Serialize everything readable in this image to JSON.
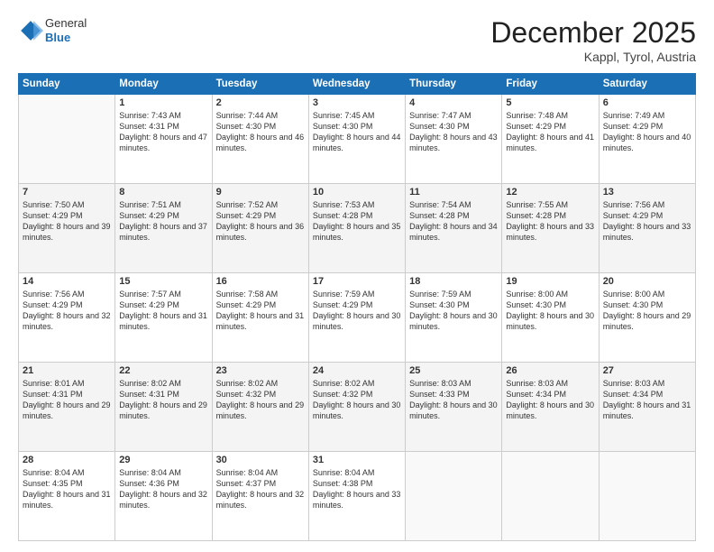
{
  "header": {
    "logo_general": "General",
    "logo_blue": "Blue",
    "title": "December 2025",
    "subtitle": "Kappl, Tyrol, Austria"
  },
  "days_of_week": [
    "Sunday",
    "Monday",
    "Tuesday",
    "Wednesday",
    "Thursday",
    "Friday",
    "Saturday"
  ],
  "weeks": [
    {
      "shaded": false,
      "days": [
        {
          "num": "",
          "empty": true,
          "sunrise": "",
          "sunset": "",
          "daylight": ""
        },
        {
          "num": "1",
          "empty": false,
          "sunrise": "Sunrise: 7:43 AM",
          "sunset": "Sunset: 4:31 PM",
          "daylight": "Daylight: 8 hours and 47 minutes."
        },
        {
          "num": "2",
          "empty": false,
          "sunrise": "Sunrise: 7:44 AM",
          "sunset": "Sunset: 4:30 PM",
          "daylight": "Daylight: 8 hours and 46 minutes."
        },
        {
          "num": "3",
          "empty": false,
          "sunrise": "Sunrise: 7:45 AM",
          "sunset": "Sunset: 4:30 PM",
          "daylight": "Daylight: 8 hours and 44 minutes."
        },
        {
          "num": "4",
          "empty": false,
          "sunrise": "Sunrise: 7:47 AM",
          "sunset": "Sunset: 4:30 PM",
          "daylight": "Daylight: 8 hours and 43 minutes."
        },
        {
          "num": "5",
          "empty": false,
          "sunrise": "Sunrise: 7:48 AM",
          "sunset": "Sunset: 4:29 PM",
          "daylight": "Daylight: 8 hours and 41 minutes."
        },
        {
          "num": "6",
          "empty": false,
          "sunrise": "Sunrise: 7:49 AM",
          "sunset": "Sunset: 4:29 PM",
          "daylight": "Daylight: 8 hours and 40 minutes."
        }
      ]
    },
    {
      "shaded": true,
      "days": [
        {
          "num": "7",
          "empty": false,
          "sunrise": "Sunrise: 7:50 AM",
          "sunset": "Sunset: 4:29 PM",
          "daylight": "Daylight: 8 hours and 39 minutes."
        },
        {
          "num": "8",
          "empty": false,
          "sunrise": "Sunrise: 7:51 AM",
          "sunset": "Sunset: 4:29 PM",
          "daylight": "Daylight: 8 hours and 37 minutes."
        },
        {
          "num": "9",
          "empty": false,
          "sunrise": "Sunrise: 7:52 AM",
          "sunset": "Sunset: 4:29 PM",
          "daylight": "Daylight: 8 hours and 36 minutes."
        },
        {
          "num": "10",
          "empty": false,
          "sunrise": "Sunrise: 7:53 AM",
          "sunset": "Sunset: 4:28 PM",
          "daylight": "Daylight: 8 hours and 35 minutes."
        },
        {
          "num": "11",
          "empty": false,
          "sunrise": "Sunrise: 7:54 AM",
          "sunset": "Sunset: 4:28 PM",
          "daylight": "Daylight: 8 hours and 34 minutes."
        },
        {
          "num": "12",
          "empty": false,
          "sunrise": "Sunrise: 7:55 AM",
          "sunset": "Sunset: 4:28 PM",
          "daylight": "Daylight: 8 hours and 33 minutes."
        },
        {
          "num": "13",
          "empty": false,
          "sunrise": "Sunrise: 7:56 AM",
          "sunset": "Sunset: 4:29 PM",
          "daylight": "Daylight: 8 hours and 33 minutes."
        }
      ]
    },
    {
      "shaded": false,
      "days": [
        {
          "num": "14",
          "empty": false,
          "sunrise": "Sunrise: 7:56 AM",
          "sunset": "Sunset: 4:29 PM",
          "daylight": "Daylight: 8 hours and 32 minutes."
        },
        {
          "num": "15",
          "empty": false,
          "sunrise": "Sunrise: 7:57 AM",
          "sunset": "Sunset: 4:29 PM",
          "daylight": "Daylight: 8 hours and 31 minutes."
        },
        {
          "num": "16",
          "empty": false,
          "sunrise": "Sunrise: 7:58 AM",
          "sunset": "Sunset: 4:29 PM",
          "daylight": "Daylight: 8 hours and 31 minutes."
        },
        {
          "num": "17",
          "empty": false,
          "sunrise": "Sunrise: 7:59 AM",
          "sunset": "Sunset: 4:29 PM",
          "daylight": "Daylight: 8 hours and 30 minutes."
        },
        {
          "num": "18",
          "empty": false,
          "sunrise": "Sunrise: 7:59 AM",
          "sunset": "Sunset: 4:30 PM",
          "daylight": "Daylight: 8 hours and 30 minutes."
        },
        {
          "num": "19",
          "empty": false,
          "sunrise": "Sunrise: 8:00 AM",
          "sunset": "Sunset: 4:30 PM",
          "daylight": "Daylight: 8 hours and 30 minutes."
        },
        {
          "num": "20",
          "empty": false,
          "sunrise": "Sunrise: 8:00 AM",
          "sunset": "Sunset: 4:30 PM",
          "daylight": "Daylight: 8 hours and 29 minutes."
        }
      ]
    },
    {
      "shaded": true,
      "days": [
        {
          "num": "21",
          "empty": false,
          "sunrise": "Sunrise: 8:01 AM",
          "sunset": "Sunset: 4:31 PM",
          "daylight": "Daylight: 8 hours and 29 minutes."
        },
        {
          "num": "22",
          "empty": false,
          "sunrise": "Sunrise: 8:02 AM",
          "sunset": "Sunset: 4:31 PM",
          "daylight": "Daylight: 8 hours and 29 minutes."
        },
        {
          "num": "23",
          "empty": false,
          "sunrise": "Sunrise: 8:02 AM",
          "sunset": "Sunset: 4:32 PM",
          "daylight": "Daylight: 8 hours and 29 minutes."
        },
        {
          "num": "24",
          "empty": false,
          "sunrise": "Sunrise: 8:02 AM",
          "sunset": "Sunset: 4:32 PM",
          "daylight": "Daylight: 8 hours and 30 minutes."
        },
        {
          "num": "25",
          "empty": false,
          "sunrise": "Sunrise: 8:03 AM",
          "sunset": "Sunset: 4:33 PM",
          "daylight": "Daylight: 8 hours and 30 minutes."
        },
        {
          "num": "26",
          "empty": false,
          "sunrise": "Sunrise: 8:03 AM",
          "sunset": "Sunset: 4:34 PM",
          "daylight": "Daylight: 8 hours and 30 minutes."
        },
        {
          "num": "27",
          "empty": false,
          "sunrise": "Sunrise: 8:03 AM",
          "sunset": "Sunset: 4:34 PM",
          "daylight": "Daylight: 8 hours and 31 minutes."
        }
      ]
    },
    {
      "shaded": false,
      "days": [
        {
          "num": "28",
          "empty": false,
          "sunrise": "Sunrise: 8:04 AM",
          "sunset": "Sunset: 4:35 PM",
          "daylight": "Daylight: 8 hours and 31 minutes."
        },
        {
          "num": "29",
          "empty": false,
          "sunrise": "Sunrise: 8:04 AM",
          "sunset": "Sunset: 4:36 PM",
          "daylight": "Daylight: 8 hours and 32 minutes."
        },
        {
          "num": "30",
          "empty": false,
          "sunrise": "Sunrise: 8:04 AM",
          "sunset": "Sunset: 4:37 PM",
          "daylight": "Daylight: 8 hours and 32 minutes."
        },
        {
          "num": "31",
          "empty": false,
          "sunrise": "Sunrise: 8:04 AM",
          "sunset": "Sunset: 4:38 PM",
          "daylight": "Daylight: 8 hours and 33 minutes."
        },
        {
          "num": "",
          "empty": true,
          "sunrise": "",
          "sunset": "",
          "daylight": ""
        },
        {
          "num": "",
          "empty": true,
          "sunrise": "",
          "sunset": "",
          "daylight": ""
        },
        {
          "num": "",
          "empty": true,
          "sunrise": "",
          "sunset": "",
          "daylight": ""
        }
      ]
    }
  ]
}
